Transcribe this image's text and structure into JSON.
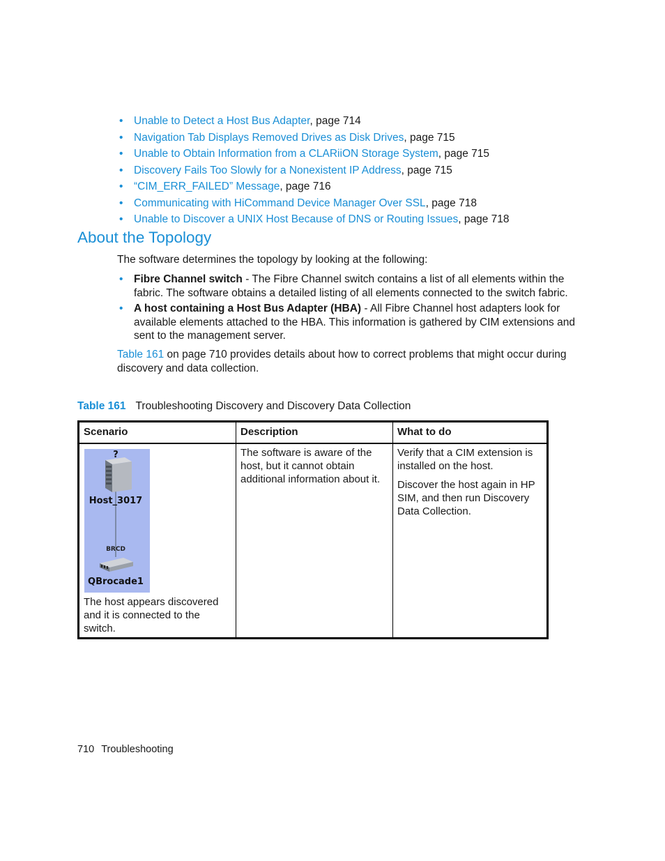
{
  "related_topics": [
    {
      "link": "Unable to Detect a Host Bus Adapter",
      "suffix": ", page 714"
    },
    {
      "link": "Navigation Tab Displays Removed Drives as Disk Drives",
      "suffix": ", page 715"
    },
    {
      "link": "Unable to Obtain Information from a CLARiiON Storage System",
      "suffix": ", page 715"
    },
    {
      "link": "Discovery Fails Too Slowly for a Nonexistent IP Address",
      "suffix": ", page 715"
    },
    {
      "link": "“CIM_ERR_FAILED” Message",
      "suffix": ", page 716"
    },
    {
      "link": "Communicating with HiCommand Device Manager Over SSL",
      "suffix": ", page 718"
    },
    {
      "link": "Unable to Discover a UNIX Host Because of DNS or Routing Issues",
      "suffix": ", page 718"
    }
  ],
  "section": {
    "heading": "About the Topology",
    "intro": "The software determines the topology by looking at the following:",
    "items": [
      {
        "term": "Fibre Channel switch",
        "text": " - The Fibre Channel switch contains a list of all elements within the fabric. The software obtains a detailed listing of all elements connected to the switch fabric."
      },
      {
        "term": "A host containing a Host Bus Adapter (HBA)",
        "text": " - All Fibre Channel host adapters look for available elements attached to the HBA. This information is gathered by CIM extensions and sent to the management server."
      }
    ],
    "ref_link": "Table 161",
    "ref_text": " on page 710 provides details about how to correct problems that might occur during discovery and data collection."
  },
  "table": {
    "label": "Table 161",
    "title": "Troubleshooting Discovery and Discovery Data Collection",
    "headers": [
      "Scenario",
      "Description",
      "What to do"
    ],
    "rows": [
      {
        "image": {
          "host_mark": "?",
          "host_label": "Host_3017",
          "switch_vendor": "BRCD",
          "switch_label": "QBrocade1"
        },
        "scenario": "The host appears discovered and it is connected to the switch.",
        "description": "The software is aware of the host, but it cannot obtain additional information about it.",
        "actions": [
          "Verify that a CIM extension is installed on the host.",
          "Discover the host again in HP SIM, and then run Discovery Data Collection."
        ]
      }
    ]
  },
  "footer": {
    "page_number": "710",
    "chapter": "Troubleshooting"
  }
}
